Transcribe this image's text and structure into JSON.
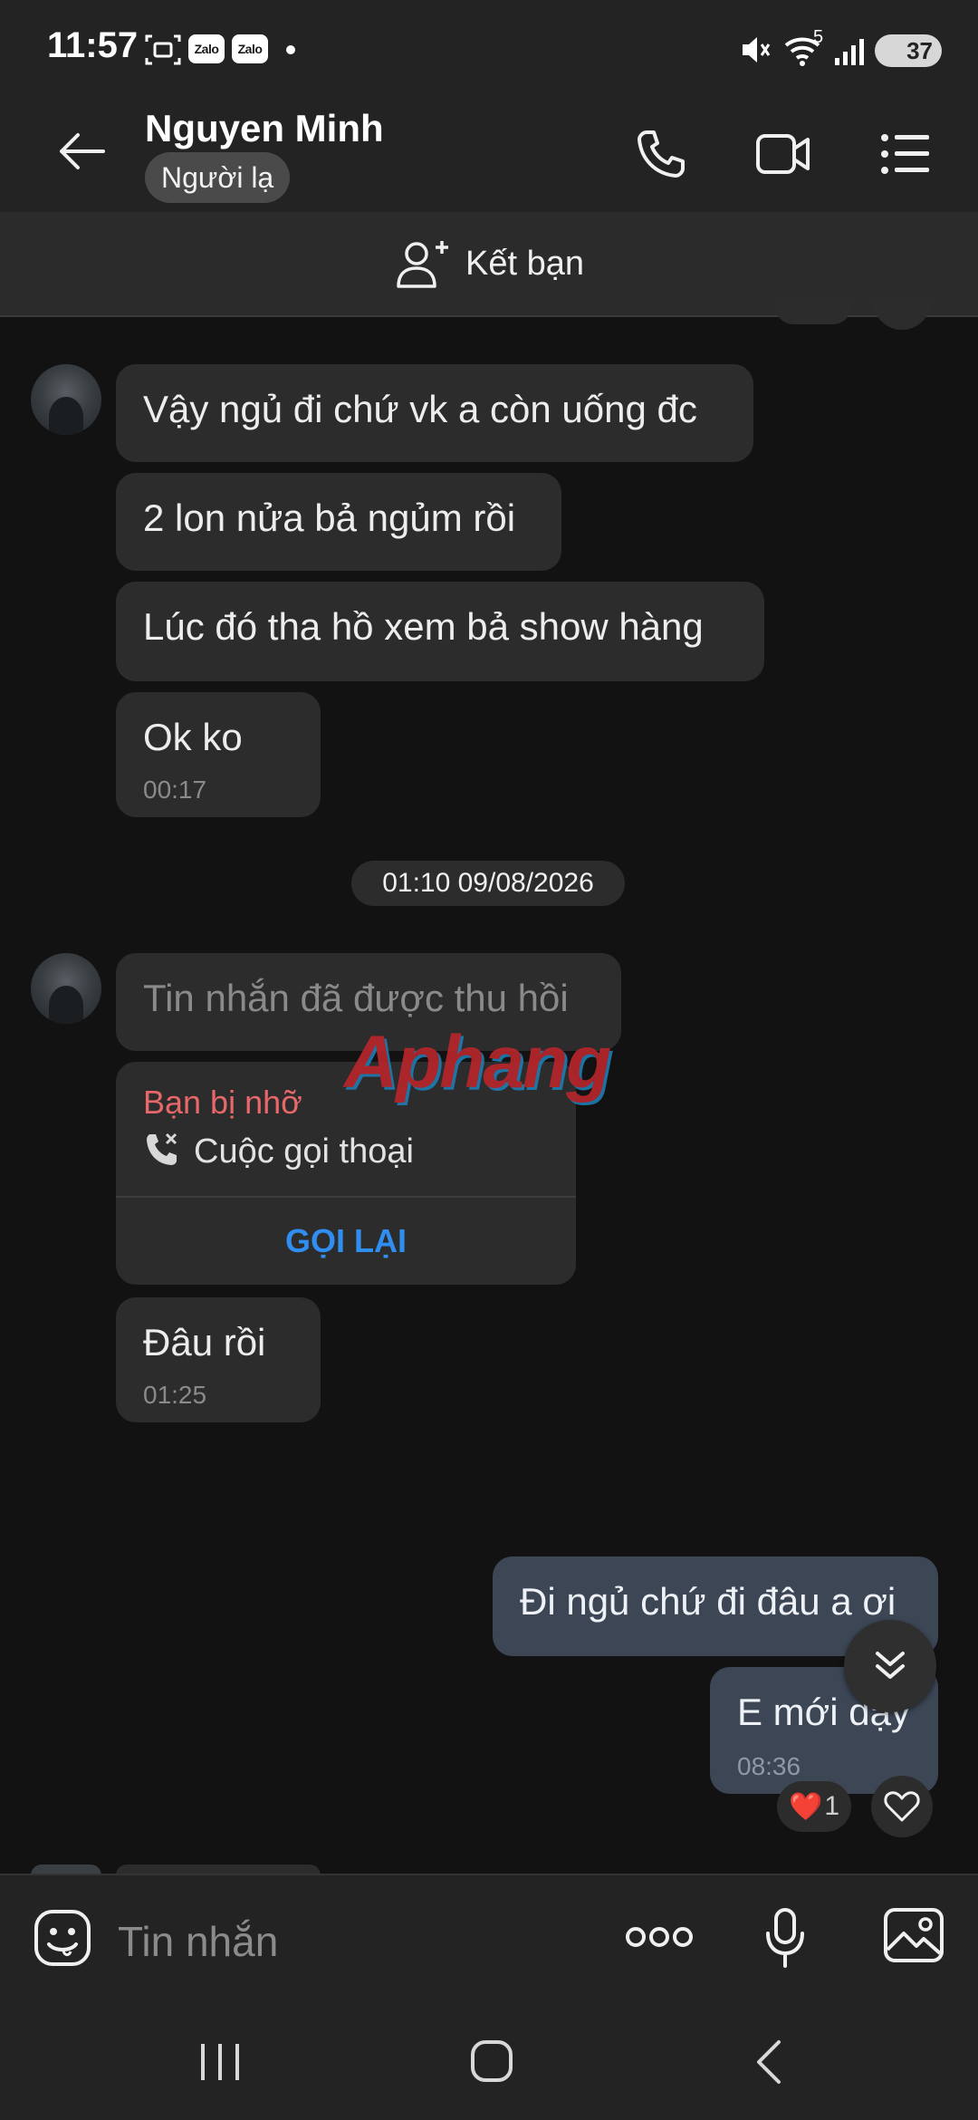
{
  "status_bar": {
    "time": "11:57",
    "zalo_badge_1": "Zalo",
    "zalo_badge_2": "Zalo",
    "wifi_level": "5",
    "battery": "37"
  },
  "header": {
    "contact_name": "Nguyen Minh",
    "badge": "Người lạ"
  },
  "friend_bar": {
    "label": "Kết bạn"
  },
  "messages_group1": [
    {
      "text": "Vậy ngủ đi chứ vk a còn uống đc"
    },
    {
      "text": "2 lon nửa bả ngủm rồi"
    },
    {
      "text": "Lúc đó tha hồ xem bả show hàng"
    },
    {
      "text": "Ok ko",
      "time": "00:17"
    }
  ],
  "date_separator": "01:10 09/08/2026",
  "messages_group2": {
    "recalled": "Tin nhắn đã được thu hồi",
    "missed_call": {
      "title": "Bạn bị nhỡ",
      "subtitle": "Cuộc gọi thoại",
      "action": "GỌI LẠI"
    },
    "last": {
      "text": "Đâu rồi",
      "time": "01:25"
    }
  },
  "watermark": "Aphang",
  "outgoing": [
    {
      "text": "Đi ngủ chứ đi đâu a ơi"
    },
    {
      "text": "E mới dạy",
      "time": "08:36"
    }
  ],
  "reaction": {
    "emoji": "❤️",
    "count": "1"
  },
  "input": {
    "placeholder": "Tin nhắn"
  },
  "colors": {
    "background": "#121212",
    "header": "#232323",
    "incoming_bubble": "#2c2c2c",
    "outgoing_bubble": "#3c4655",
    "missed_call_red": "#e8676a",
    "link_blue": "#2f8ef0"
  }
}
